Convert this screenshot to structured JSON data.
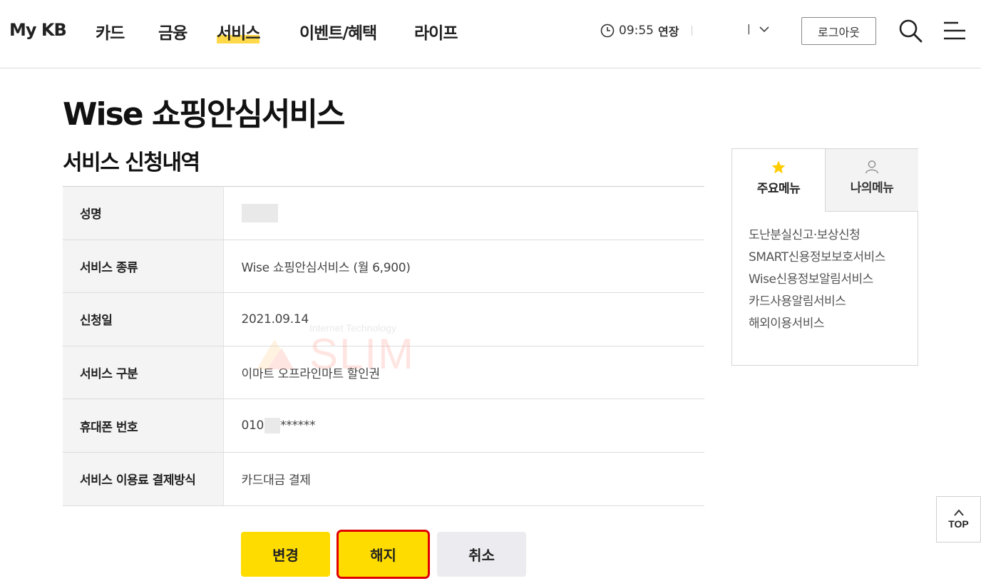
{
  "header": {
    "logo": "My KB",
    "nav": [
      "카드",
      "금융",
      "서비스",
      "이벤트/혜택",
      "라이프"
    ],
    "active_nav": "서비스",
    "session_time": "09:55",
    "extend_label": "연장",
    "lang_label": "|",
    "logout_label": "로그아웃",
    "icons": [
      "clock-icon",
      "chevron-down-icon",
      "search-icon",
      "hamburger-menu-icon"
    ]
  },
  "page": {
    "title": "Wise 쇼핑안심서비스",
    "section_title": "서비스 신청내역"
  },
  "table": {
    "rows": [
      {
        "label": "성명",
        "value": ""
      },
      {
        "label": "서비스 종류",
        "value": "Wise 쇼핑안심서비스 (월 6,900)"
      },
      {
        "label": "신청일",
        "value": "2021.09.14"
      },
      {
        "label": "서비스 구분",
        "value": "이마트 오프라인마트 할인권"
      },
      {
        "label": "휴대폰 번호",
        "value_prefix": "010",
        "value_suffix": "******"
      },
      {
        "label": "서비스 이용료 결제방식",
        "value": "카드대금 결제"
      }
    ]
  },
  "watermark": {
    "top": "Internet Technology",
    "main": "SLIM"
  },
  "buttons": {
    "change": "변경",
    "terminate": "해지",
    "cancel": "취소"
  },
  "side_menu": {
    "tabs": [
      "주요메뉴",
      "나의메뉴"
    ],
    "items": [
      "도난분실신고·보상신청",
      "SMART신용정보보호서비스",
      "Wise신용정보알림서비스",
      "카드사용알림서비스",
      "해외이용서비스"
    ]
  },
  "top_button": "TOP",
  "colors": {
    "accent_yellow": "#ffdc00",
    "highlight_red": "#e00000",
    "nav_highlight": "#ffd94a"
  }
}
